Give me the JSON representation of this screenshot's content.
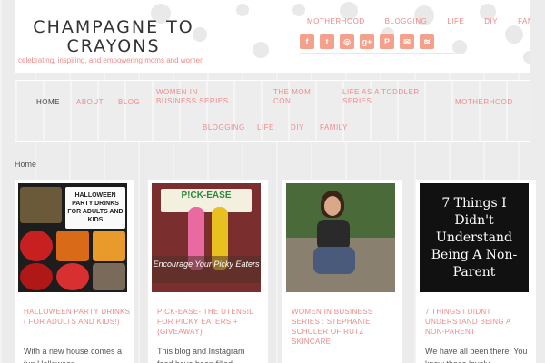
{
  "site": {
    "title": "CHAMPAGNE TO CRAYONS",
    "tagline": "celebrating, inspiring, and empowering moms and women"
  },
  "top_nav": [
    "MOTHERHOOD",
    "BLOGGING",
    "LIFE",
    "DIY",
    "FAMILY"
  ],
  "social": [
    {
      "icon": "facebook-icon",
      "glyph": "f"
    },
    {
      "icon": "twitter-icon",
      "glyph": "t"
    },
    {
      "icon": "instagram-icon",
      "glyph": "◎"
    },
    {
      "icon": "google-plus-icon",
      "glyph": "g+"
    },
    {
      "icon": "pinterest-icon",
      "glyph": "P"
    },
    {
      "icon": "email-icon",
      "glyph": "✉"
    },
    {
      "icon": "rss-icon",
      "glyph": "≋"
    }
  ],
  "main_nav": {
    "home": "HOME",
    "about": "ABOUT",
    "blog": "BLOG",
    "women_in_business": "WOMEN IN BUSINESS SERIES",
    "mom_con": "THE MOM CON",
    "toddler": "LIFE AS A TODDLER SERIES",
    "motherhood": "MOTHERHOOD",
    "blogging": "BLOGGING",
    "life": "LIFE",
    "diy": "DIY",
    "family": "FAMILY"
  },
  "breadcrumb": "Home",
  "posts": [
    {
      "title": "HALLOWEEN PARTY DRINKS ( FOR ADULTS AND KIDS!)",
      "excerpt": "With a new house comes a fun Halloween",
      "image_text": "HALLOWEEN PARTY DRINKS FOR ADULTS AND KIDS"
    },
    {
      "title": "PICK-EASE- THE UTENSIL FOR PICKY EATERS + {GIVEAWAY}",
      "excerpt": "This blog and Instagram feed have been filled",
      "image_text": "Encourage Your Picky Eaters"
    },
    {
      "title": "WOMEN IN BUSINESS SERIES : STEPHANIE SCHULER OF RUTZ SKINCARE",
      "excerpt": "",
      "image_text": ""
    },
    {
      "title": "7 THINGS I DIDNT UNDERSTAND BEING A NON-PARENT",
      "excerpt": "We have all been there. You know those lovely",
      "image_text": "7 Things I Didn't Understand Being A Non- Parent"
    }
  ],
  "colors": {
    "accent": "#f08a8a",
    "social": "#f4a08a",
    "text": "#555555"
  }
}
